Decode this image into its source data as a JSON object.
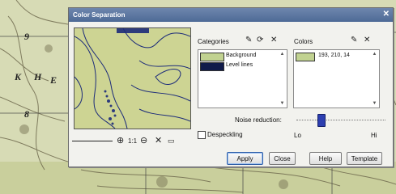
{
  "map": {
    "labels": [
      "9",
      "K",
      "H",
      "E",
      "8"
    ]
  },
  "dialog": {
    "title": "Color Separation",
    "close_icon": "close-x"
  },
  "preview": {
    "zoom_tools": [
      "zoom-in-icon",
      "zoom-fit-icon",
      "zoom-out-icon",
      "clear-icon",
      "window-icon"
    ]
  },
  "categories": {
    "label": "Categories",
    "items": [
      {
        "label": "Background",
        "color": "#c1d291"
      },
      {
        "label": "Level lines",
        "color": "#101a4a"
      }
    ]
  },
  "colors": {
    "label": "Colors",
    "items": [
      {
        "value": "193,  210,  14",
        "color": "#c1d291"
      }
    ]
  },
  "noise": {
    "label": "Noise reduction:",
    "min_label": "Lo",
    "max_label": "Hi",
    "level": 0.2
  },
  "despeckling": {
    "label": "Despeckling",
    "checked": false
  },
  "buttons": {
    "apply": "Apply",
    "close": "Close",
    "help": "Help",
    "template": "Template"
  }
}
